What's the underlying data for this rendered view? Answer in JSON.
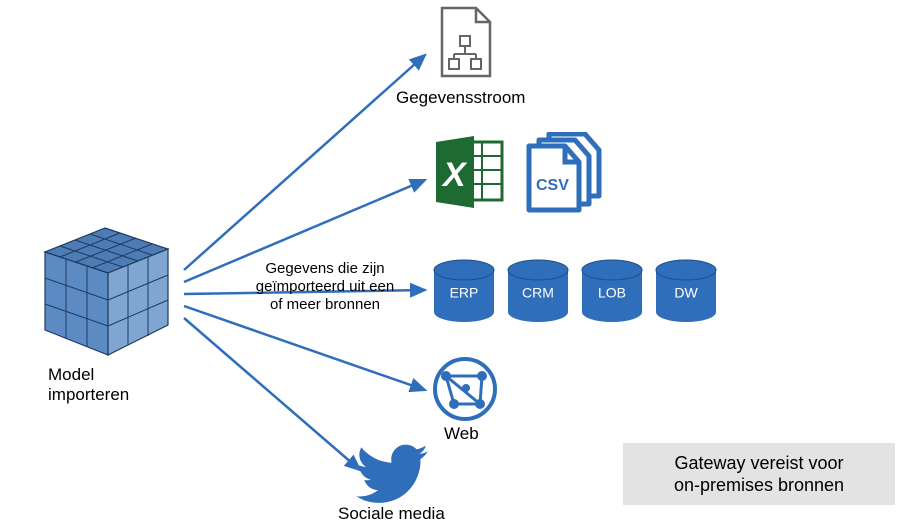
{
  "source": {
    "title_line1": "Model",
    "title_line2": "importeren"
  },
  "edge_label": {
    "line1": "Gegevens die zijn",
    "line2": "geïmporteerd uit een",
    "line3": "of meer bronnen"
  },
  "targets": {
    "dataflow": {
      "label": "Gegevensstroom"
    },
    "files": {
      "excel_letter": "X",
      "csv_label": "CSV"
    },
    "databases": {
      "items": [
        "ERP",
        "CRM",
        "LOB",
        "DW"
      ]
    },
    "web": {
      "label": "Web"
    },
    "social": {
      "label": "Sociale media"
    }
  },
  "note": {
    "line1": "Gateway vereist voor",
    "line2": "on-premises bronnen"
  },
  "colors": {
    "arrow": "#2F6EBA",
    "db_fill": "#2F6EBA",
    "csv_stroke": "#2F6EBA",
    "excel_green_light": "#2E8B3D",
    "excel_green_dark": "#1D6B33",
    "web_stroke": "#2F6EBA",
    "twitter": "#2F6EBA",
    "cube_light": "#7FA6D0",
    "cube_tile": "#4C7BB5"
  }
}
